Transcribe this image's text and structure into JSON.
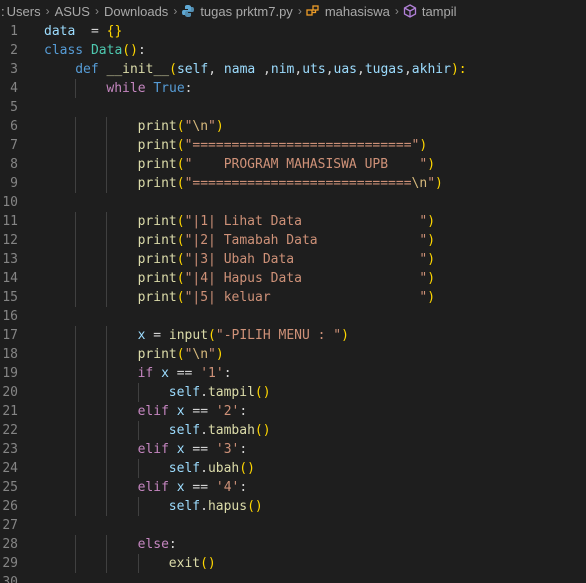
{
  "breadcrumb": {
    "parts": [
      ":",
      "Users",
      "ASUS",
      "Downloads"
    ],
    "file": "tugas prktm7.py",
    "class_name": "mahasiswa",
    "method_name": "tampil"
  },
  "editor": {
    "lines": [
      {
        "n": "1",
        "tokens": [
          [
            "var",
            "data"
          ],
          [
            "",
            "  = "
          ],
          [
            "brace",
            "{}"
          ]
        ]
      },
      {
        "n": "2",
        "tokens": [
          [
            "kw",
            "class"
          ],
          [
            "",
            " "
          ],
          [
            "cls",
            "Data"
          ],
          [
            "brace",
            "()"
          ],
          [
            "",
            ":"
          ]
        ]
      },
      {
        "n": "3",
        "tokens": [
          [
            "",
            ""
          ],
          [
            "kw",
            "def"
          ],
          [
            "",
            " "
          ],
          [
            "fn",
            "__init__"
          ],
          [
            "brace",
            "("
          ],
          [
            "self",
            "self"
          ],
          [
            "",
            ", "
          ],
          [
            "var",
            "nama"
          ],
          [
            "",
            " ,"
          ],
          [
            "var",
            "nim"
          ],
          [
            "",
            ","
          ],
          [
            "var",
            "uts"
          ],
          [
            "",
            ","
          ],
          [
            "var",
            "uas"
          ],
          [
            "",
            ","
          ],
          [
            "var",
            "tugas"
          ],
          [
            "",
            ","
          ],
          [
            "var",
            "akhir"
          ],
          [
            "brace",
            "):"
          ]
        ]
      },
      {
        "n": "4",
        "tokens": [
          [
            "ctl",
            "while"
          ],
          [
            "",
            " "
          ],
          [
            "kw",
            "True"
          ],
          [
            "",
            ":"
          ]
        ]
      },
      {
        "n": "5",
        "tokens": []
      },
      {
        "n": "6",
        "tokens": [
          [
            "fn",
            "print"
          ],
          [
            "brace",
            "("
          ],
          [
            "str",
            "\""
          ],
          [
            "esc",
            "\\n"
          ],
          [
            "str",
            "\""
          ],
          [
            "brace",
            ")"
          ]
        ]
      },
      {
        "n": "7",
        "tokens": [
          [
            "fn",
            "print"
          ],
          [
            "brace",
            "("
          ],
          [
            "str",
            "\"============================\""
          ],
          [
            "brace",
            ")"
          ]
        ]
      },
      {
        "n": "8",
        "tokens": [
          [
            "fn",
            "print"
          ],
          [
            "brace",
            "("
          ],
          [
            "str",
            "\"    PROGRAM MAHASISWA UPB    \""
          ],
          [
            "brace",
            ")"
          ]
        ]
      },
      {
        "n": "9",
        "tokens": [
          [
            "fn",
            "print"
          ],
          [
            "brace",
            "("
          ],
          [
            "str",
            "\"============================"
          ],
          [
            "esc",
            "\\n"
          ],
          [
            "str",
            "\""
          ],
          [
            "brace",
            ")"
          ]
        ]
      },
      {
        "n": "10",
        "tokens": []
      },
      {
        "n": "11",
        "tokens": [
          [
            "fn",
            "print"
          ],
          [
            "brace",
            "("
          ],
          [
            "str",
            "\"|1| Lihat Data               \""
          ],
          [
            "brace",
            ")"
          ]
        ]
      },
      {
        "n": "12",
        "tokens": [
          [
            "fn",
            "print"
          ],
          [
            "brace",
            "("
          ],
          [
            "str",
            "\"|2| Tamabah Data             \""
          ],
          [
            "brace",
            ")"
          ]
        ]
      },
      {
        "n": "13",
        "tokens": [
          [
            "fn",
            "print"
          ],
          [
            "brace",
            "("
          ],
          [
            "str",
            "\"|3| Ubah Data                \""
          ],
          [
            "brace",
            ")"
          ]
        ]
      },
      {
        "n": "14",
        "tokens": [
          [
            "fn",
            "print"
          ],
          [
            "brace",
            "("
          ],
          [
            "str",
            "\"|4| Hapus Data               \""
          ],
          [
            "brace",
            ")"
          ]
        ]
      },
      {
        "n": "15",
        "tokens": [
          [
            "fn",
            "print"
          ],
          [
            "brace",
            "("
          ],
          [
            "str",
            "\"|5| keluar                   \""
          ],
          [
            "brace",
            ")"
          ]
        ]
      },
      {
        "n": "16",
        "tokens": []
      },
      {
        "n": "17",
        "tokens": [
          [
            "var",
            "x"
          ],
          [
            "",
            " = "
          ],
          [
            "fn",
            "input"
          ],
          [
            "brace",
            "("
          ],
          [
            "str",
            "\"-PILIH MENU : \""
          ],
          [
            "brace",
            ")"
          ]
        ]
      },
      {
        "n": "18",
        "tokens": [
          [
            "fn",
            "print"
          ],
          [
            "brace",
            "("
          ],
          [
            "str",
            "\""
          ],
          [
            "esc",
            "\\n"
          ],
          [
            "str",
            "\""
          ],
          [
            "brace",
            ")"
          ]
        ]
      },
      {
        "n": "19",
        "tokens": [
          [
            "ctl",
            "if"
          ],
          [
            "",
            " "
          ],
          [
            "var",
            "x"
          ],
          [
            "",
            " == "
          ],
          [
            "str",
            "'1'"
          ],
          [
            "",
            ":"
          ]
        ]
      },
      {
        "n": "20",
        "tokens": [
          [
            "self",
            "self"
          ],
          [
            "",
            "."
          ],
          [
            "fn",
            "tampil"
          ],
          [
            "brace",
            "()"
          ]
        ]
      },
      {
        "n": "21",
        "tokens": [
          [
            "ctl",
            "elif"
          ],
          [
            "",
            " "
          ],
          [
            "var",
            "x"
          ],
          [
            "",
            " == "
          ],
          [
            "str",
            "'2'"
          ],
          [
            "",
            ":"
          ]
        ]
      },
      {
        "n": "22",
        "tokens": [
          [
            "self",
            "self"
          ],
          [
            "",
            "."
          ],
          [
            "fn",
            "tambah"
          ],
          [
            "brace",
            "()"
          ]
        ]
      },
      {
        "n": "23",
        "tokens": [
          [
            "ctl",
            "elif"
          ],
          [
            "",
            " "
          ],
          [
            "var",
            "x"
          ],
          [
            "",
            " == "
          ],
          [
            "str",
            "'3'"
          ],
          [
            "",
            ":"
          ]
        ]
      },
      {
        "n": "24",
        "tokens": [
          [
            "self",
            "self"
          ],
          [
            "",
            "."
          ],
          [
            "fn",
            "ubah"
          ],
          [
            "brace",
            "()"
          ]
        ]
      },
      {
        "n": "25",
        "tokens": [
          [
            "ctl",
            "elif"
          ],
          [
            "",
            " "
          ],
          [
            "var",
            "x"
          ],
          [
            "",
            " == "
          ],
          [
            "str",
            "'4'"
          ],
          [
            "",
            ":"
          ]
        ]
      },
      {
        "n": "26",
        "tokens": [
          [
            "self",
            "self"
          ],
          [
            "",
            "."
          ],
          [
            "fn",
            "hapus"
          ],
          [
            "brace",
            "()"
          ]
        ]
      },
      {
        "n": "27",
        "tokens": []
      },
      {
        "n": "28",
        "tokens": [
          [
            "ctl",
            "else"
          ],
          [
            "",
            ":"
          ]
        ]
      },
      {
        "n": "29",
        "tokens": [
          [
            "fn",
            "exit"
          ],
          [
            "brace",
            "()"
          ]
        ]
      },
      {
        "n": "30",
        "tokens": []
      }
    ]
  }
}
